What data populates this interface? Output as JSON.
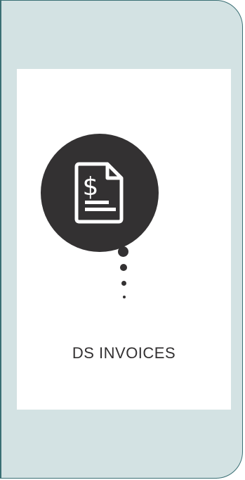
{
  "app": {
    "label": "DS INVOICES",
    "icon": "invoice-dollar-icon",
    "connector_icon": "vertical-dots-icon"
  },
  "colors": {
    "panel_bg": "#d3e2e3",
    "panel_border": "#3a6f74",
    "card_bg": "#ffffff",
    "icon_bg": "#333132"
  }
}
